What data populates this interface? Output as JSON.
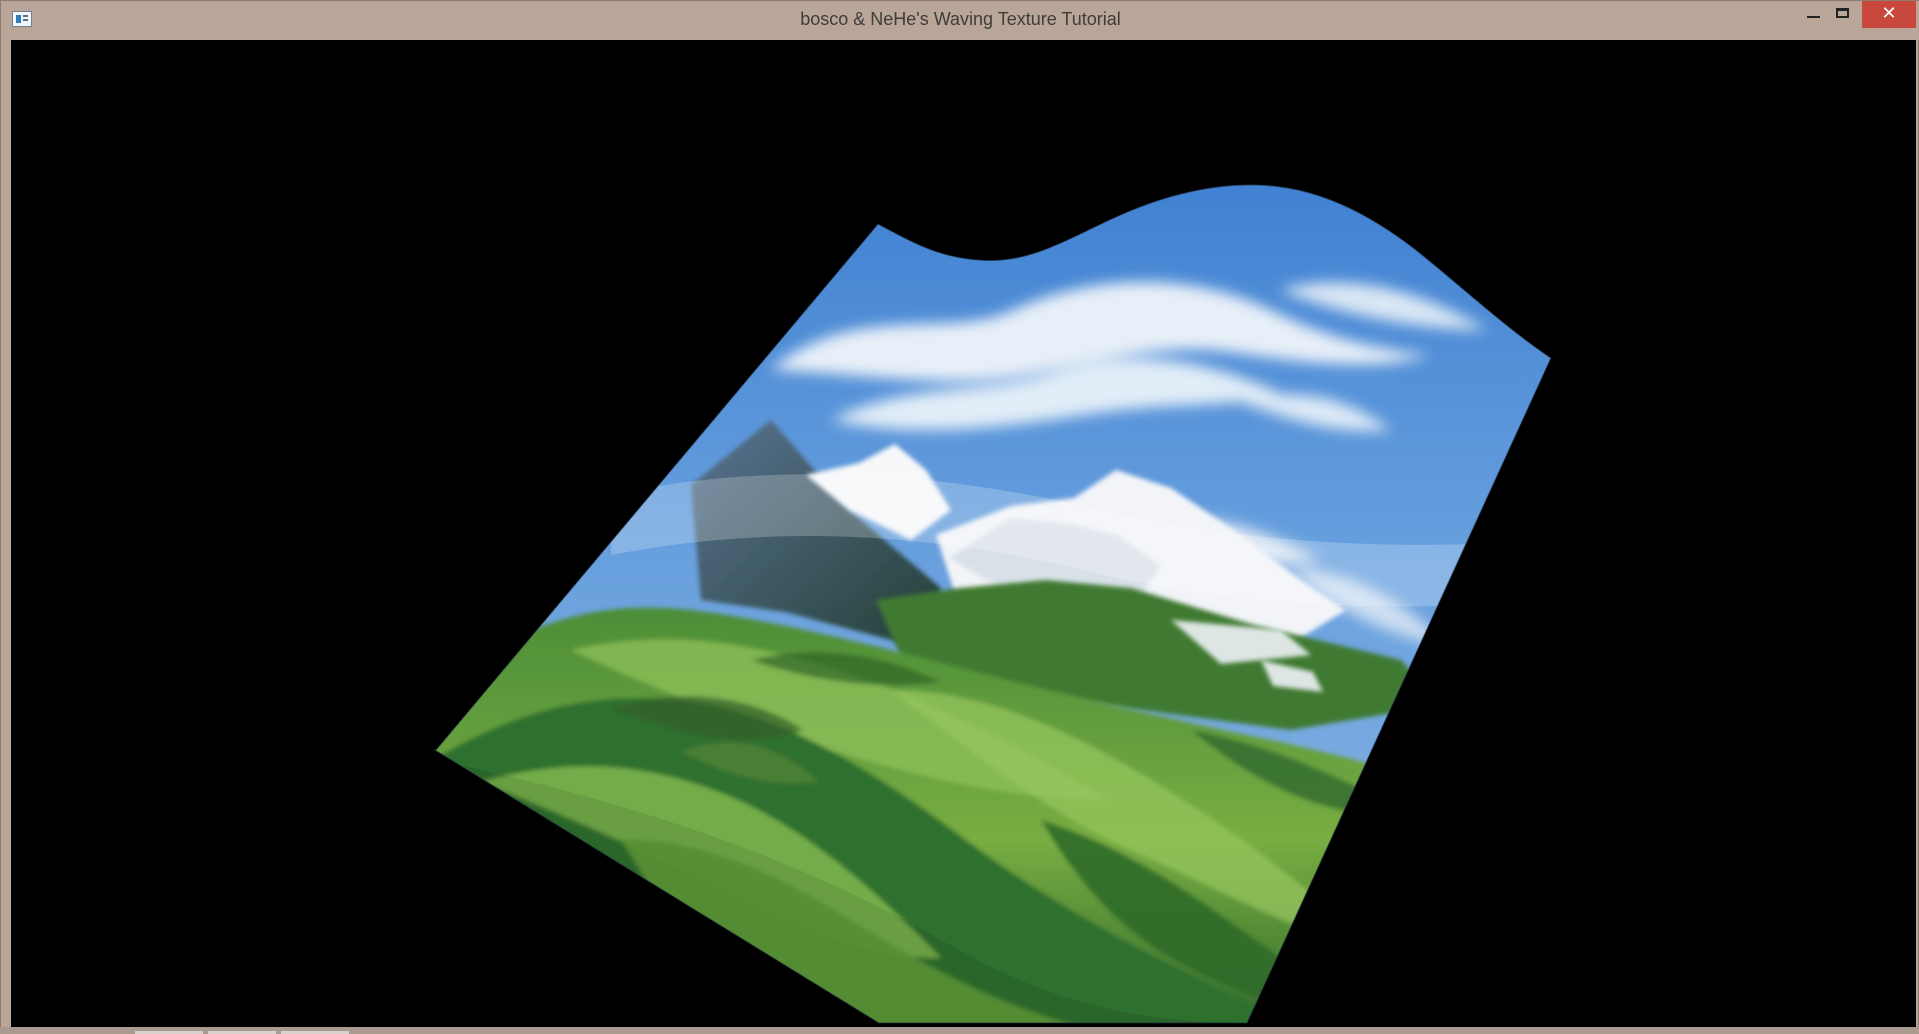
{
  "window": {
    "title": "bosco & NeHe's Waving Texture Tutorial"
  },
  "icons": {
    "app": "application-window-icon",
    "minimize": "minimize-icon",
    "maximize": "maximize-icon",
    "close": "close-icon"
  },
  "controls": {
    "close_glyph": "✕"
  },
  "scene": {
    "description_colors": {
      "sky": "#5f97d7",
      "cloud": "#f3f6fa",
      "snow": "#f7f8fa",
      "rock": "#516b83",
      "grass": "#78ad42",
      "dark_green": "#2f6a2a"
    }
  }
}
